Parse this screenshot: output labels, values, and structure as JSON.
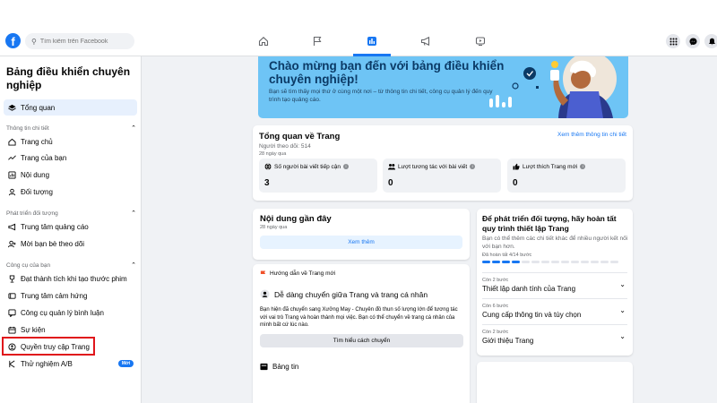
{
  "topbar": {
    "logo": "f",
    "search_placeholder": "Tìm kiếm trên Facebook",
    "nav_icons": [
      "home-icon",
      "flag-icon",
      "insights-icon",
      "megaphone-icon",
      "video-icon"
    ],
    "right_icons": [
      "menu-grid-icon",
      "messenger-icon",
      "bell-icon"
    ]
  },
  "sidebar": {
    "title": "Bảng điều khiển chuyên nghiệp",
    "overview": "Tổng quan",
    "sections": [
      {
        "label": "Thông tin chi tiết",
        "items": [
          "Trang chủ",
          "Trang của bạn",
          "Nội dung",
          "Đối tượng"
        ]
      },
      {
        "label": "Phát triển đối tượng",
        "items": [
          "Trung tâm quảng cáo",
          "Mời bạn bè theo dõi"
        ]
      },
      {
        "label": "Công cụ của bạn",
        "items": [
          "Đạt thành tích khi tạo thước phim",
          "Trung tâm cảm hứng",
          "Công cụ quản lý bình luận",
          "Sự kiện",
          "Quyền truy cập Trang",
          "Thử nghiệm A/B"
        ]
      }
    ],
    "new_badge": "Mới"
  },
  "banner": {
    "title": "Chào mừng bạn đến với bảng điều khiển chuyên nghiệp!",
    "text": "Bạn sẽ tìm thấy mọi thứ ở cùng một nơi – từ thông tin chi tiết, công cụ quản lý đến quy trình tạo quảng cáo."
  },
  "overview": {
    "title": "Tổng quan về Trang",
    "followers": "Người theo dõi: 514",
    "period": "28 ngày qua",
    "link": "Xem thêm thông tin chi tiết",
    "stats": [
      {
        "label": "Số người bài viết tiếp cận",
        "value": "3"
      },
      {
        "label": "Lượt tương tác với bài viết",
        "value": "0"
      },
      {
        "label": "Lượt thích Trang mới",
        "value": "0"
      }
    ]
  },
  "recent": {
    "title": "Nội dung gần đây",
    "period": "28 ngày qua",
    "button": "Xem thêm"
  },
  "guide": {
    "header": "Hướng dẫn về Trang mới",
    "title": "Dễ dàng chuyển giữa Trang và trang cá nhân",
    "text": "Bạn hiện đã chuyển sang Xưởng May - Chuyên đồ thun số lượng lớn để tương tác với vai trò Trang và hoàn thành mọi việc. Bạn có thể chuyển về trang cá nhân của mình bất cứ lúc nào.",
    "button": "Tìm hiểu cách chuyển",
    "feed": "Bảng tin"
  },
  "setup": {
    "title": "Để phát triển đối tượng, hãy hoàn tất quy trình thiết lập Trang",
    "text": "Bạn có thể thêm các chi tiết khác để nhiều người kết nối với bạn hơn.",
    "progress_label": "Đã hoàn tất 4/14 bước",
    "progress_done": 4,
    "progress_total": 14,
    "steps": [
      {
        "count": "Còn 2 bước",
        "title": "Thiết lập danh tính của Trang"
      },
      {
        "count": "Còn 6 bước",
        "title": "Cung cấp thông tin và tùy chọn"
      },
      {
        "count": "Còn 2 bước",
        "title": "Giới thiệu Trang"
      }
    ]
  },
  "colors": {
    "accent": "#1877f2",
    "banner": "#6ec4f5",
    "highlight": "#e0151b"
  }
}
